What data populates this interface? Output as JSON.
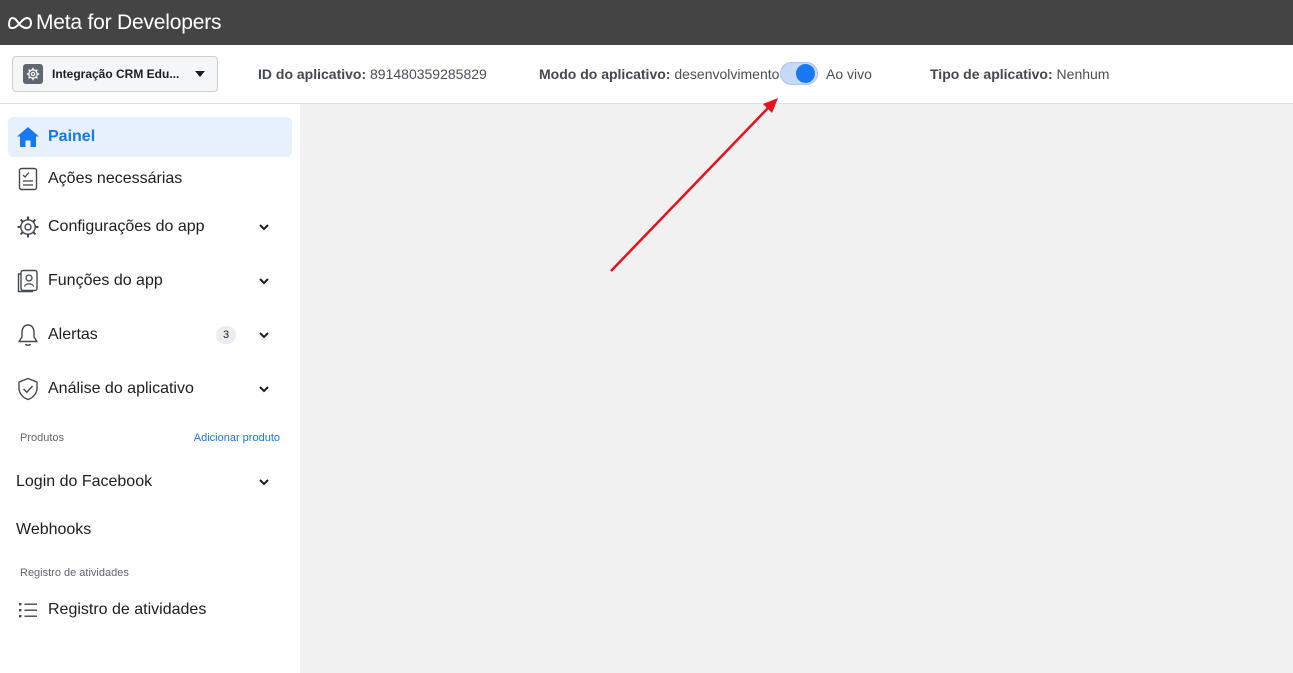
{
  "header": {
    "brand": "Meta for Developers"
  },
  "appbar": {
    "app_name": "Integração CRM Edu...",
    "id_label": "ID do aplicativo:",
    "id_value": "891480359285829",
    "mode_label": "Modo do aplicativo:",
    "mode_value": "desenvolvimento",
    "live_label": "Ao vivo",
    "type_label": "Tipo de aplicativo:",
    "type_value": "Nenhum"
  },
  "sidebar": {
    "items": [
      {
        "label": "Painel",
        "icon": "home-icon"
      },
      {
        "label": "Ações necessárias",
        "icon": "checklist-icon"
      },
      {
        "label": "Configurações do app",
        "icon": "gear-icon"
      },
      {
        "label": "Funções do app",
        "icon": "id-badge-icon"
      },
      {
        "label": "Alertas",
        "icon": "bell-icon",
        "badge": "3"
      },
      {
        "label": "Análise do aplicativo",
        "icon": "shield-check-icon"
      }
    ],
    "products_label": "Produtos",
    "add_product_label": "Adicionar produto",
    "product_items": [
      {
        "label": "Login do Facebook"
      },
      {
        "label": "Webhooks"
      }
    ],
    "activity_section_label": "Registro de atividades",
    "activity_item": {
      "label": "Registro de atividades",
      "icon": "list-icon"
    }
  },
  "colors": {
    "accent": "#1877f2",
    "topbar": "#444444",
    "annotation_arrow": "#e8111b"
  }
}
